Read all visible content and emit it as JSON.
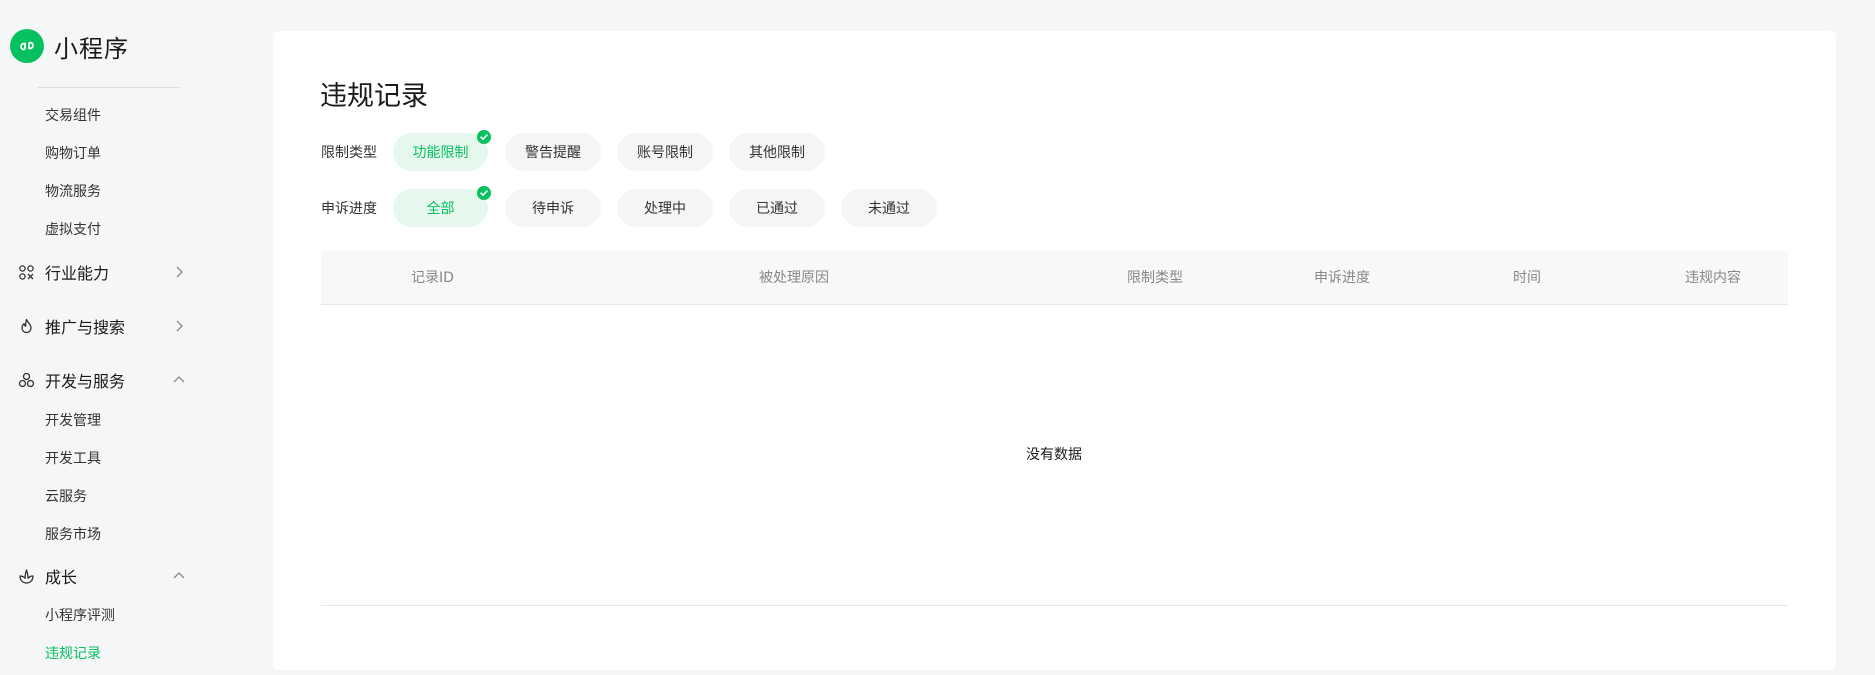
{
  "brand": {
    "title": "小程序",
    "logo_icon": "mini-program-logo-icon"
  },
  "sidebar": {
    "trade_items": [
      "交易组件",
      "购物订单",
      "物流服务",
      "虚拟支付"
    ],
    "groups": [
      {
        "label": "行业能力",
        "icon": "industry-icon",
        "expanded": false
      },
      {
        "label": "推广与搜索",
        "icon": "promotion-icon",
        "expanded": false
      },
      {
        "label": "开发与服务",
        "icon": "dev-service-icon",
        "expanded": true
      },
      {
        "label": "成长",
        "icon": "growth-icon",
        "expanded": true
      }
    ],
    "dev_items": [
      "开发管理",
      "开发工具",
      "云服务",
      "服务市场"
    ],
    "growth_items": [
      "小程序评测",
      "违规记录"
    ]
  },
  "main": {
    "title": "违规记录",
    "filters": {
      "type_label": "限制类型",
      "type_options": [
        "功能限制",
        "警告提醒",
        "账号限制",
        "其他限制"
      ],
      "type_selected": "功能限制",
      "progress_label": "申诉进度",
      "progress_options": [
        "全部",
        "待申诉",
        "处理中",
        "已通过",
        "未通过"
      ],
      "progress_selected": "全部"
    },
    "table": {
      "columns": [
        "记录ID",
        "被处理原因",
        "限制类型",
        "申诉进度",
        "时间",
        "违规内容"
      ],
      "empty_text": "没有数据"
    }
  },
  "colors": {
    "accent": "#07c160",
    "chip_bg": "#f5f5f5",
    "chip_selected_bg": "#e6f8ee"
  }
}
